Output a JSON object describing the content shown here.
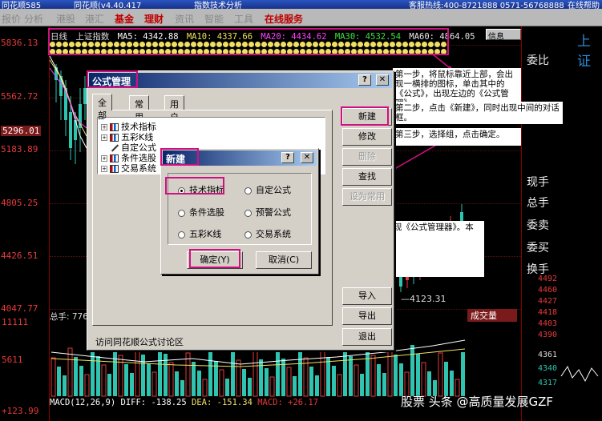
{
  "window": {
    "title_segments": [
      "同花顺585",
      "同花顺(v4.40.417",
      "指数技术分析",
      "客服热线:400-8721888 0571-56768888",
      "在线帮助"
    ]
  },
  "menu": {
    "items": [
      "报价",
      "分析",
      "港股",
      "港汇",
      "基金",
      "理财",
      "资讯",
      "智能",
      "工具",
      "在线服务"
    ],
    "highlighted": [
      "基金",
      "理财",
      "在线服务"
    ]
  },
  "chart": {
    "period": "日线",
    "index_name": "上证指数",
    "ma": [
      {
        "label": "MA5: 4342.88",
        "color": "#ffffff"
      },
      {
        "label": "MA10: 4337.66",
        "color": "#f0e060"
      },
      {
        "label": "MA20: 4434.62",
        "color": "#ff40ff"
      },
      {
        "label": "MA30: 4532.54",
        "color": "#40e040"
      },
      {
        "label": "MA60: 4864.05",
        "color": "#e8e8e8"
      }
    ],
    "price_labels": [
      "5836.13",
      "5562.72",
      "5296.01",
      "5183.89",
      "4805.25",
      "4426.51",
      "4047.77",
      "11111",
      "5611",
      "+123.99"
    ],
    "low_marker": "—4123.31",
    "volume_label": "总手: 776",
    "indicator_tag": "成交量",
    "macd": {
      "prefix": "MACD(12,26,9)",
      "diff": "DIFF: -138.25",
      "dea": "DEA: -151.34",
      "macd": "MACD: +26.17",
      "colors": {
        "prefix": "#ffffff",
        "diff": "#ffffff",
        "dea": "#f0e060",
        "macd": "#e83a3a"
      }
    },
    "info_button": "信息",
    "corner_char": "上证"
  },
  "right_panel": {
    "items": [
      "委比",
      "现手",
      "总手",
      "委卖",
      "委买",
      "换手"
    ],
    "quotes": [
      "4492",
      "4460",
      "4427",
      "4418",
      "4403",
      "4390",
      "4361",
      "4340",
      "4317"
    ]
  },
  "notes": {
    "step1": "第一步，将鼠标靠近上部，会出现一横排的图标，单击其中的《公式》，出现左边的《公式管理》。",
    "step2": "第二步，点击《新建》，同时出现中间的对话框。",
    "step3": "第三步，选择组，点击确定。",
    "after": "之后会出现《公式管理器》。本图略去。"
  },
  "formula_dialog": {
    "title": "公式管理",
    "help": "?",
    "close": "✕",
    "tabs": [
      "全部",
      "常用",
      "用户"
    ],
    "tree": [
      {
        "label": "技术指标",
        "icon": "chart-icon"
      },
      {
        "label": "五彩K线",
        "icon": "chart-icon"
      },
      {
        "label": "自定公式",
        "icon": "pen-icon"
      },
      {
        "label": "条件选股",
        "icon": "chart-icon"
      },
      {
        "label": "交易系统",
        "icon": "chart-icon"
      }
    ],
    "buttons": [
      "新建",
      "修改",
      "删除",
      "查找",
      "设为常用",
      "导入",
      "导出",
      "退出"
    ],
    "disabled": [
      "删除",
      "设为常用"
    ],
    "footer": "访问同花顺公式讨论区"
  },
  "new_dialog": {
    "title": "新建",
    "help": "?",
    "close": "✕",
    "options": [
      "技术指标",
      "自定公式",
      "条件选股",
      "预警公式",
      "五彩K线",
      "交易系统"
    ],
    "selected": "技术指标",
    "ok": "确定(Y)",
    "cancel": "取消(C)"
  },
  "watermark": "股票   头条 @高质量发展GZF"
}
